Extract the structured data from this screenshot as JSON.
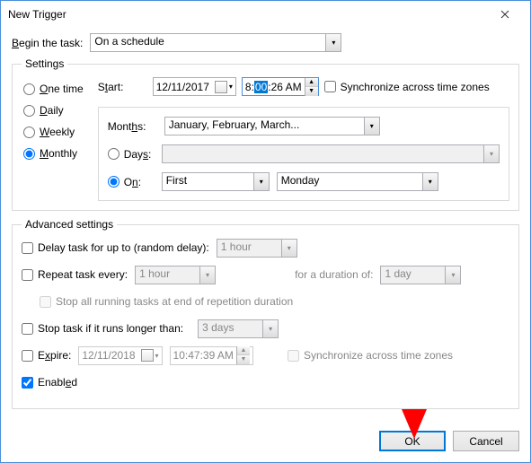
{
  "window": {
    "title": "New Trigger"
  },
  "begin": {
    "label": "Begin the task:",
    "value": "On a schedule"
  },
  "settings": {
    "legend": "Settings",
    "freq": {
      "one_time": "One time",
      "daily": "Daily",
      "weekly": "Weekly",
      "monthly": "Monthly",
      "selected": "monthly"
    },
    "start_label": "Start:",
    "start_date": "12/11/2017",
    "start_time_h": "8:",
    "start_time_m": "00",
    "start_time_rest": ":26 AM",
    "sync_label": "Synchronize across time zones",
    "months_label": "Months:",
    "months_value": "January, February, March...",
    "days_label": "Days:",
    "on_label": "On:",
    "on_first": "First",
    "on_day": "Monday"
  },
  "adv": {
    "legend": "Advanced settings",
    "delay_label": "Delay task for up to (random delay):",
    "delay_value": "1 hour",
    "repeat_label": "Repeat task every:",
    "repeat_value": "1 hour",
    "duration_label": "for a duration of:",
    "duration_value": "1 day",
    "stop_all_label": "Stop all running tasks at end of repetition duration",
    "stop_if_label": "Stop task if it runs longer than:",
    "stop_if_value": "3 days",
    "expire_label": "Expire:",
    "expire_date": "12/11/2018",
    "expire_time": "10:47:39 AM",
    "sync2_label": "Synchronize across time zones",
    "enabled_label": "Enabled"
  },
  "buttons": {
    "ok": "OK",
    "cancel": "Cancel"
  }
}
